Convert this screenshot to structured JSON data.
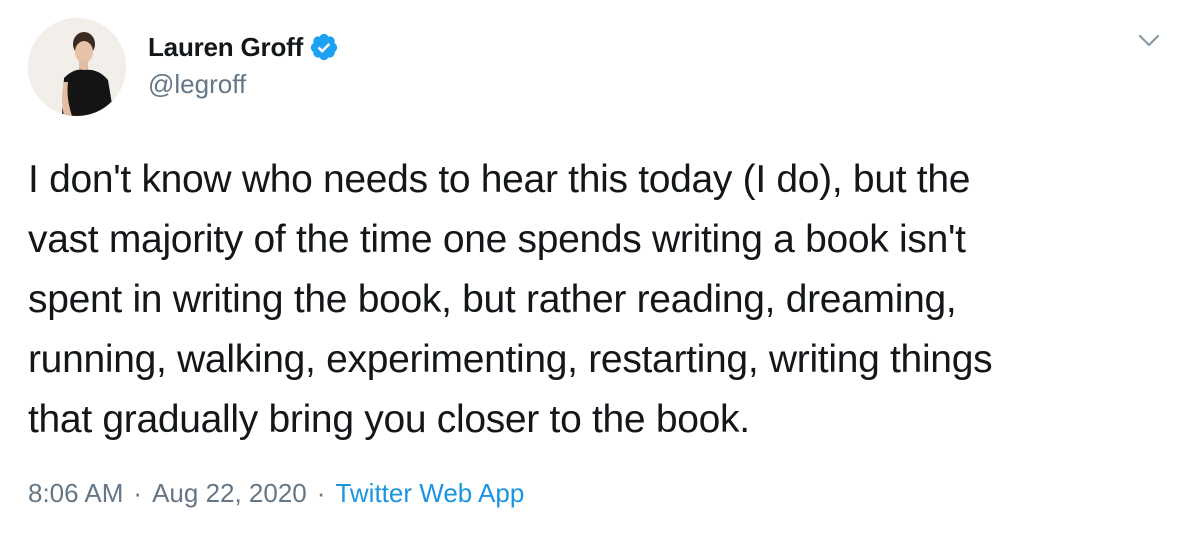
{
  "author": {
    "display_name": "Lauren Groff",
    "handle": "@legroff",
    "verified": true
  },
  "icons": {
    "verified": "verified-badge-icon",
    "menu": "chevron-down-icon"
  },
  "colors": {
    "text": "#14171a",
    "secondary": "#657786",
    "link": "#1b95e0",
    "verified": "#1da1f2"
  },
  "tweet": {
    "lines": [
      "I don't know who needs to hear this today (I do), but the",
      "vast majority of the time one spends writing a book isn't",
      "spent in writing the book, but rather reading, dreaming,",
      "running, walking, experimenting, restarting, writing things",
      "that gradually bring you closer to the book."
    ]
  },
  "meta": {
    "time": "8:06 AM",
    "separator": "·",
    "date": "Aug 22, 2020",
    "source": "Twitter Web App"
  }
}
